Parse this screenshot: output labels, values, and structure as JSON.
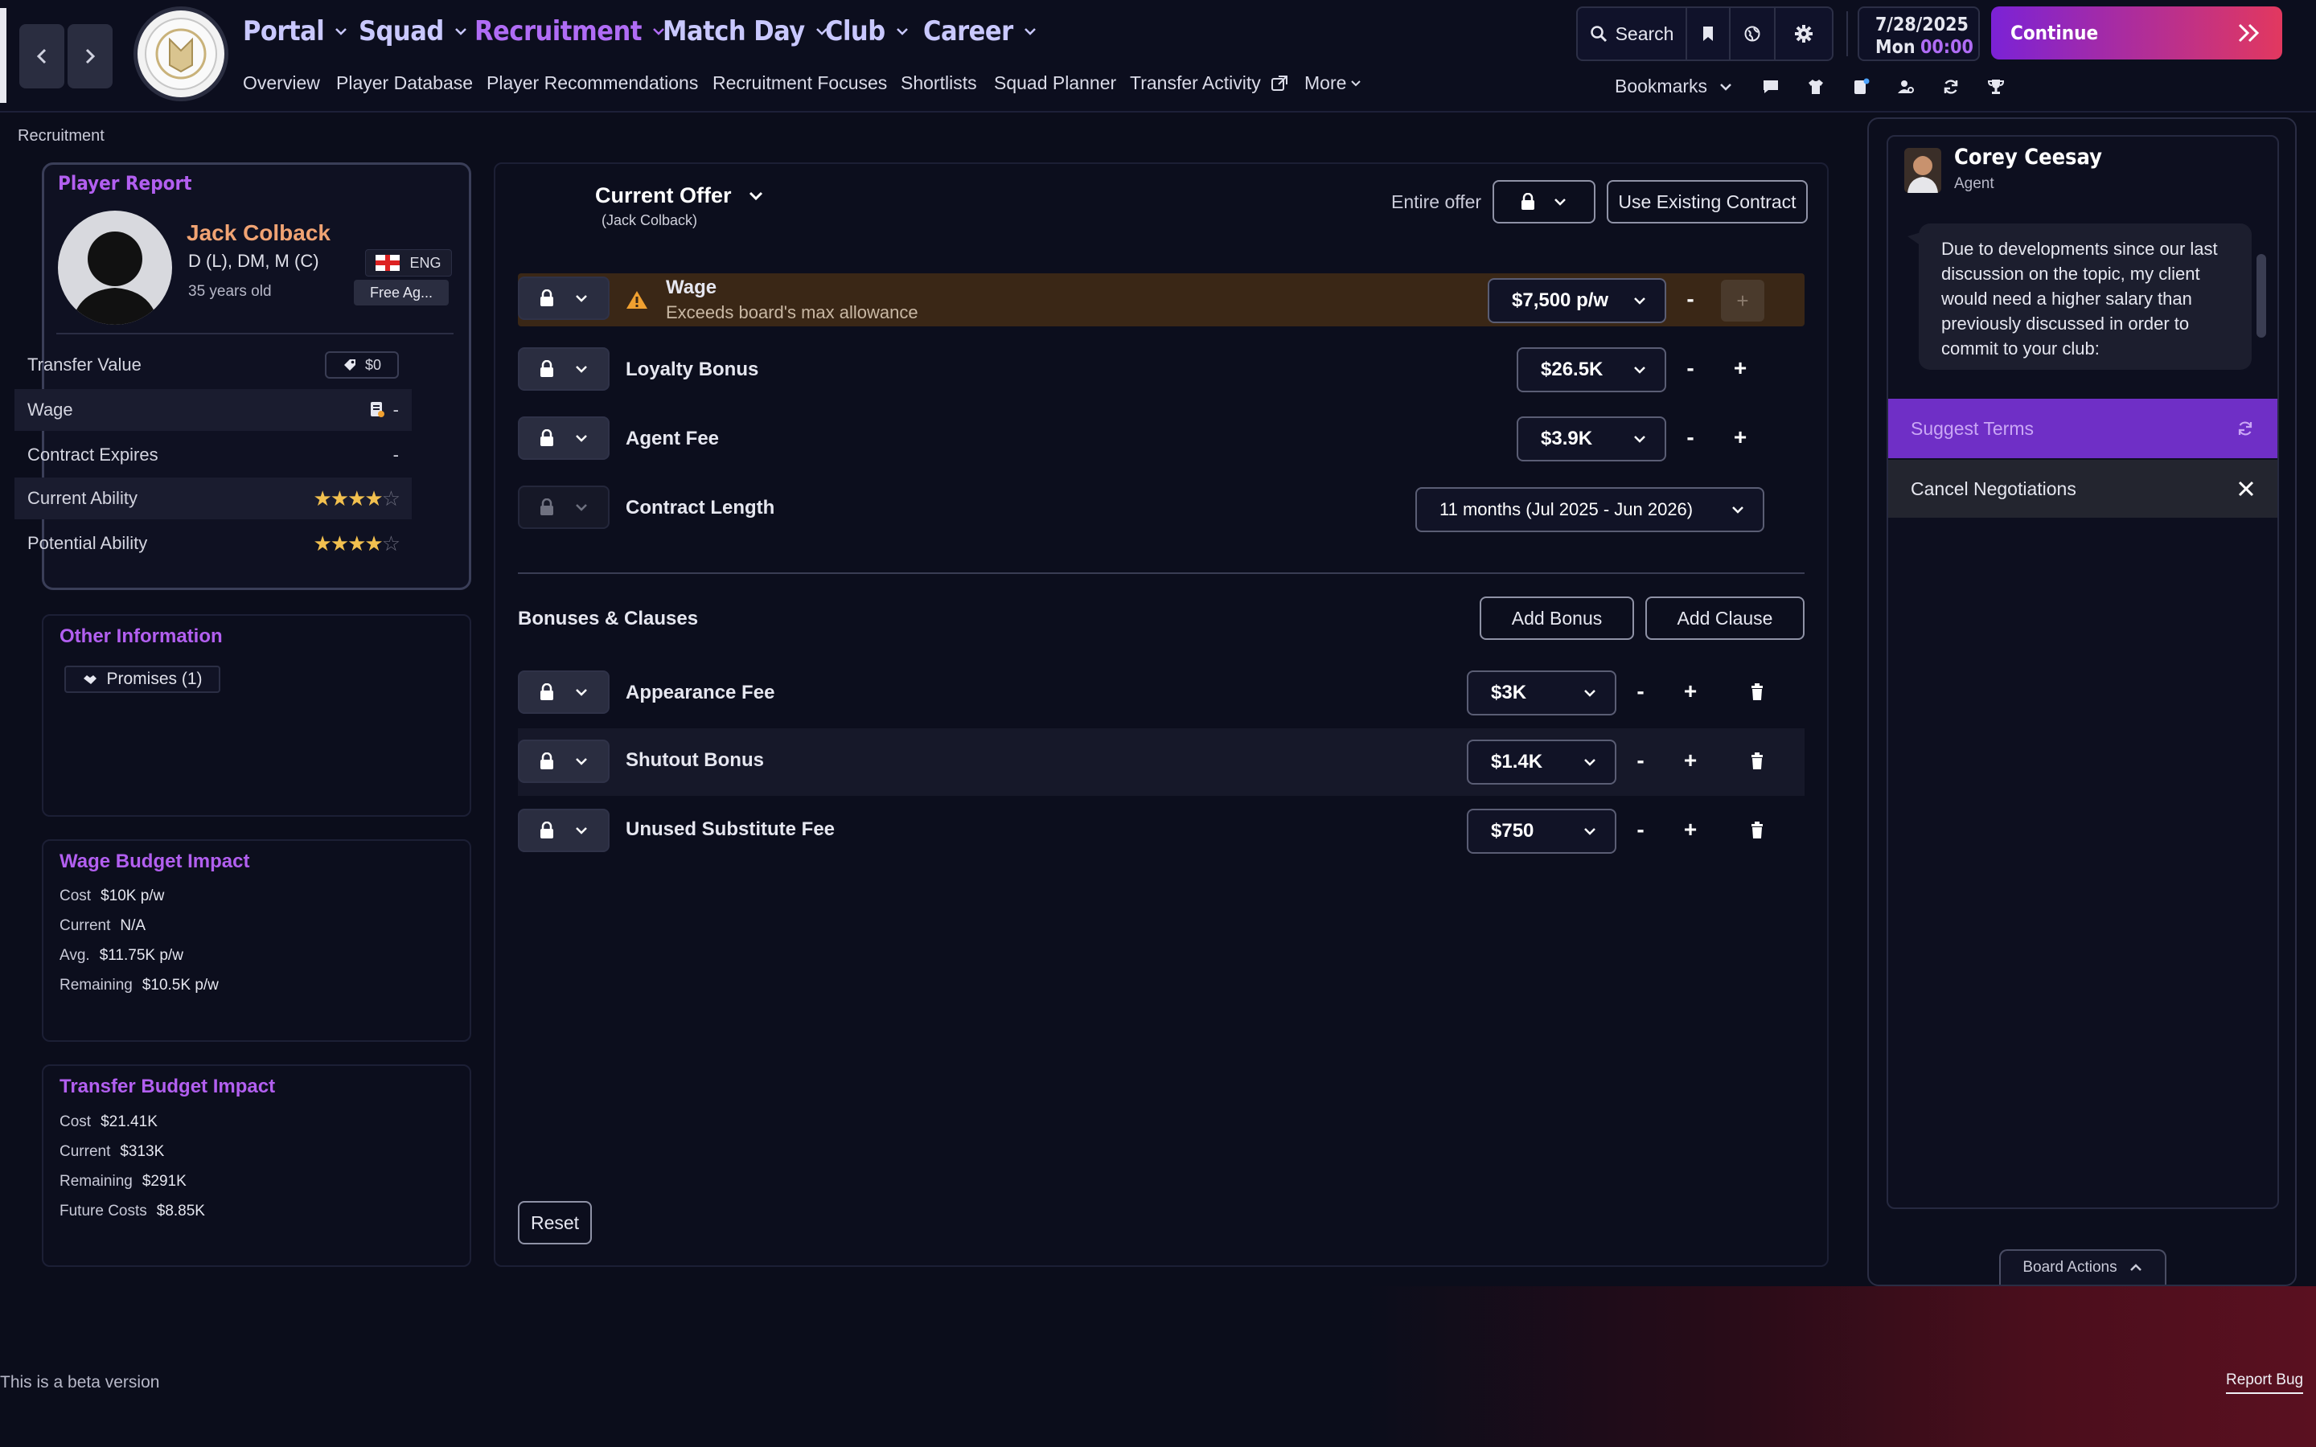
{
  "nav": {
    "main": [
      "Portal",
      "Squad",
      "Recruitment",
      "Match Day",
      "Club",
      "Career"
    ],
    "sub": [
      "Overview",
      "Player Database",
      "Player Recommendations",
      "Recruitment Focuses",
      "Shortlists",
      "Squad Planner",
      "Transfer Activity",
      "More"
    ],
    "search": "Search",
    "bookmarks": "Bookmarks",
    "date": "7/28/2025",
    "day": "Mon",
    "time": "00:00",
    "continue": "Continue"
  },
  "breadcrumb": "Recruitment",
  "player": {
    "card_title": "Player Report",
    "name": "Jack Colback",
    "positions": "D (L), DM, M (C)",
    "age": "35 years old",
    "nation": "ENG",
    "status": "Free Ag...",
    "rows": [
      {
        "label": "Transfer Value",
        "value": "$0"
      },
      {
        "label": "Wage",
        "value": "-"
      },
      {
        "label": "Contract Expires",
        "value": "-"
      },
      {
        "label": "Current Ability",
        "stars": 4
      },
      {
        "label": "Potential Ability",
        "stars": 4
      }
    ]
  },
  "other_info": {
    "title": "Other Information",
    "promises": "Promises (1)"
  },
  "wage_budget": {
    "title": "Wage Budget Impact",
    "rows": [
      {
        "label": "Cost",
        "value": "$10K p/w"
      },
      {
        "label": "Current",
        "value": "N/A"
      },
      {
        "label": "Avg.",
        "value": "$11.75K p/w"
      },
      {
        "label": "Remaining",
        "value": "$10.5K p/w"
      }
    ]
  },
  "transfer_budget": {
    "title": "Transfer Budget Impact",
    "rows": [
      {
        "label": "Cost",
        "value": "$21.41K"
      },
      {
        "label": "Current",
        "value": "$313K"
      },
      {
        "label": "Remaining",
        "value": "$291K"
      },
      {
        "label": "Future Costs",
        "value": "$8.85K"
      }
    ]
  },
  "offer": {
    "title": "Current Offer",
    "subtitle": "(Jack Colback)",
    "entire_offer": "Entire offer",
    "use_existing": "Use Existing Contract",
    "wage_label": "Wage",
    "wage_warning": "Exceeds board's max allowance",
    "wage_value": "$7,500 p/w",
    "loyalty_label": "Loyalty Bonus",
    "loyalty_value": "$26.5K",
    "agent_label": "Agent Fee",
    "agent_value": "$3.9K",
    "length_label": "Contract Length",
    "length_value": "11 months (Jul 2025 - Jun 2026)",
    "bonuses_title": "Bonuses & Clauses",
    "add_bonus": "Add Bonus",
    "add_clause": "Add Clause",
    "appearance_label": "Appearance Fee",
    "appearance_value": "$3K",
    "shutout_label": "Shutout Bonus",
    "shutout_value": "$1.4K",
    "unused_label": "Unused Substitute Fee",
    "unused_value": "$750",
    "reset": "Reset",
    "minus": "-",
    "plus": "+"
  },
  "agent": {
    "name": "Corey Ceesay",
    "role": "Agent",
    "message": "Due to developments since our last discussion on the topic, my client would need a higher salary than previously discussed in order to commit to your club:",
    "suggest": "Suggest Terms",
    "cancel": "Cancel Negotiations",
    "board_actions": "Board Actions"
  },
  "footer": {
    "beta": "This is a beta version",
    "report_bug": "Report Bug"
  },
  "colors": {
    "accent": "#b25ff0",
    "warning_row": "#3a2716",
    "continue_start": "#7b22d6",
    "continue_end": "#e2385f",
    "star": "#f2c04f"
  }
}
